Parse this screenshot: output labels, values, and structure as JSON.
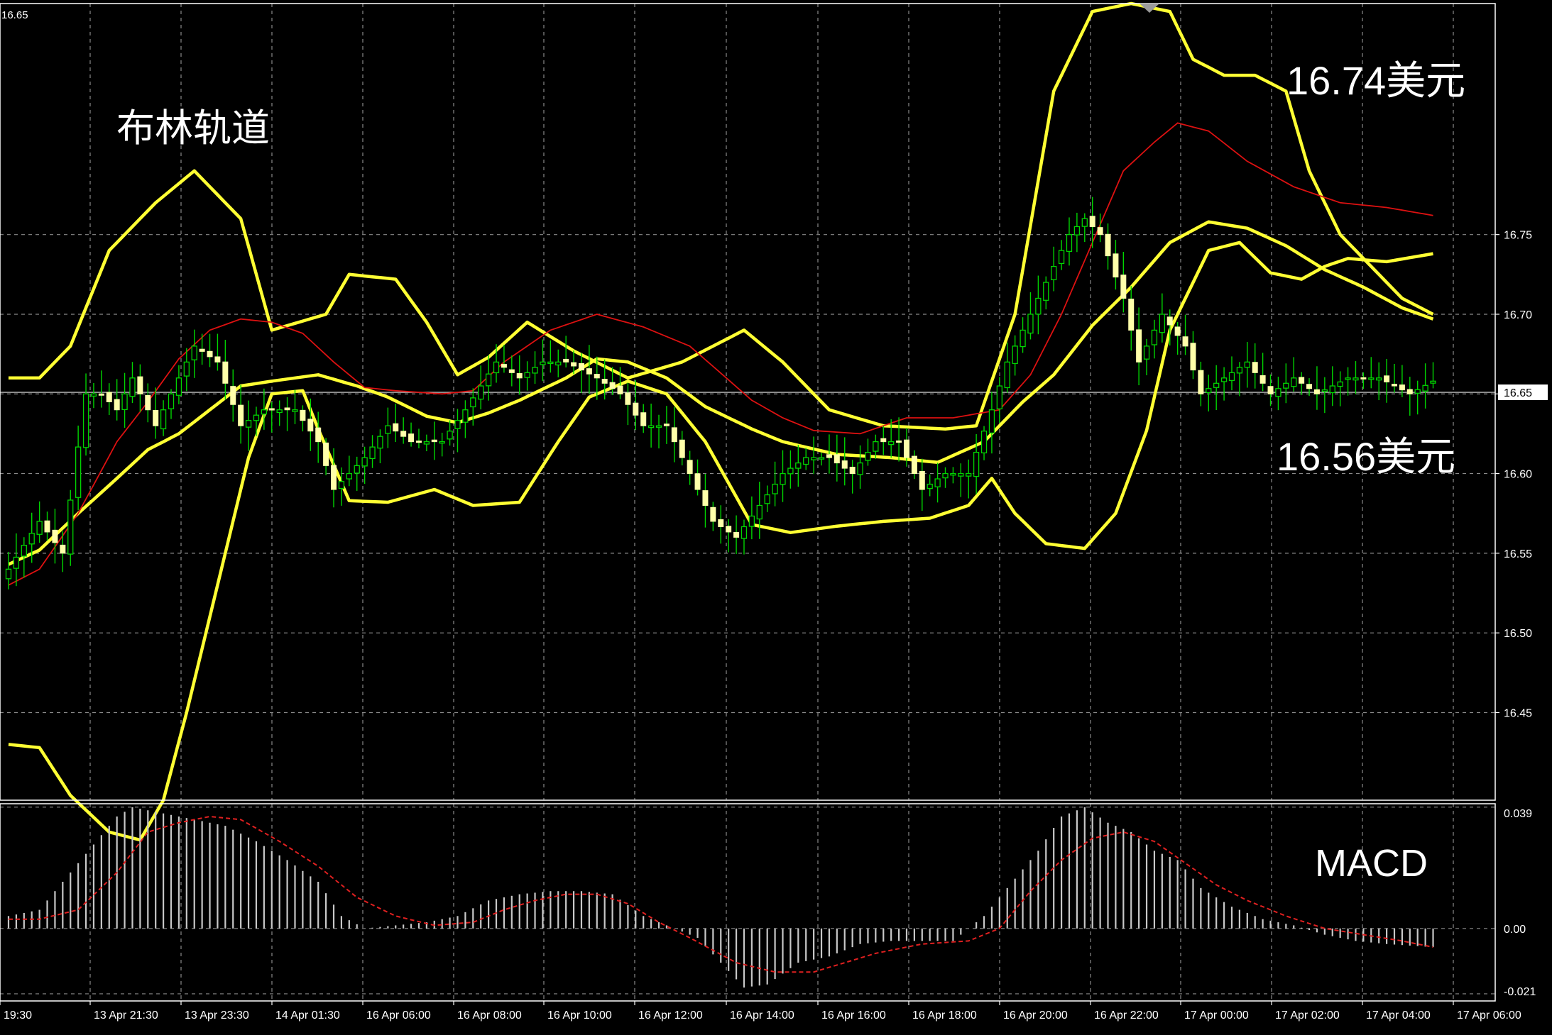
{
  "colors": {
    "background": "#000000",
    "frame": "#ffffff",
    "grid": "#b8b8b8",
    "axis_text": "#ffffff",
    "bull_wick": "#00d400",
    "bull_body": "#000000",
    "bear_body": "#ffffaa",
    "bollinger": "#ffff33",
    "moving_average": "#dd1111",
    "macd_hist": "#c8c8c8",
    "macd_signal": "#e02020",
    "price_line": "#c0c0c0"
  },
  "annotations": {
    "title": "布林轨道",
    "upper_price": "16.74美元",
    "lower_price": "16.56美元",
    "macd_label": "MACD"
  },
  "chart_data": [
    {
      "type": "candlestick",
      "title": "布林轨道",
      "top_left_price": "16.65",
      "ylim": [
        16.395,
        16.895
      ],
      "y_ticks": [
        "16.75",
        "16.70",
        "16.65",
        "16.60",
        "16.55",
        "16.50",
        "16.45"
      ],
      "y_tick_values": [
        16.75,
        16.7,
        16.65,
        16.6,
        16.55,
        16.5,
        16.45
      ],
      "current_price": "16.65",
      "current_price_value": 16.651,
      "x_labels": [
        "19:30",
        "13 Apr 21:30",
        "13 Apr 23:30",
        "14 Apr 01:30",
        "16 Apr 06:00",
        "16 Apr 08:00",
        "16 Apr 10:00",
        "16 Apr 12:00",
        "16 Apr 14:00",
        "16 Apr 16:00",
        "16 Apr 18:00",
        "16 Apr 20:00",
        "16 Apr 22:00",
        "17 Apr 00:00",
        "17 Apr 02:00",
        "17 Apr 04:00",
        "17 Apr 06:00"
      ],
      "bar_count": 185,
      "close_anchors": [
        [
          0,
          16.54
        ],
        [
          4,
          16.57
        ],
        [
          7,
          16.55
        ],
        [
          10,
          16.65
        ],
        [
          12,
          16.65
        ],
        [
          14,
          16.64
        ],
        [
          16,
          16.66
        ],
        [
          19,
          16.63
        ],
        [
          21,
          16.65
        ],
        [
          24,
          16.68
        ],
        [
          27,
          16.67
        ],
        [
          30,
          16.63
        ],
        [
          33,
          16.64
        ],
        [
          37,
          16.64
        ],
        [
          40,
          16.62
        ],
        [
          42,
          16.59
        ],
        [
          46,
          16.61
        ],
        [
          49,
          16.63
        ],
        [
          52,
          16.62
        ],
        [
          56,
          16.62
        ],
        [
          59,
          16.64
        ],
        [
          63,
          16.67
        ],
        [
          66,
          16.66
        ],
        [
          69,
          16.67
        ],
        [
          72,
          16.67
        ],
        [
          76,
          16.66
        ],
        [
          79,
          16.65
        ],
        [
          82,
          16.63
        ],
        [
          85,
          16.63
        ],
        [
          88,
          16.6
        ],
        [
          91,
          16.57
        ],
        [
          94,
          16.56
        ],
        [
          97,
          16.58
        ],
        [
          100,
          16.6
        ],
        [
          103,
          16.61
        ],
        [
          106,
          16.61
        ],
        [
          109,
          16.6
        ],
        [
          112,
          16.62
        ],
        [
          115,
          16.62
        ],
        [
          118,
          16.59
        ],
        [
          121,
          16.6
        ],
        [
          124,
          16.6
        ],
        [
          127,
          16.64
        ],
        [
          129,
          16.67
        ],
        [
          131,
          16.69
        ],
        [
          134,
          16.72
        ],
        [
          137,
          16.75
        ],
        [
          139,
          16.76
        ],
        [
          141,
          16.75
        ],
        [
          144,
          16.71
        ],
        [
          146,
          16.67
        ],
        [
          149,
          16.7
        ],
        [
          152,
          16.68
        ],
        [
          154,
          16.65
        ],
        [
          157,
          16.66
        ],
        [
          160,
          16.67
        ],
        [
          163,
          16.65
        ],
        [
          166,
          16.66
        ],
        [
          169,
          16.65
        ],
        [
          173,
          16.66
        ],
        [
          177,
          16.66
        ],
        [
          181,
          16.65
        ],
        [
          184,
          16.658
        ]
      ],
      "bollinger_upper_anchors": [
        [
          0,
          16.66
        ],
        [
          4,
          16.66
        ],
        [
          8,
          16.68
        ],
        [
          13,
          16.74
        ],
        [
          19,
          16.77
        ],
        [
          24,
          16.79
        ],
        [
          30,
          16.76
        ],
        [
          34,
          16.69
        ],
        [
          41,
          16.7
        ],
        [
          44,
          16.725
        ],
        [
          50,
          16.722
        ],
        [
          54,
          16.695
        ],
        [
          58,
          16.662
        ],
        [
          62,
          16.673
        ],
        [
          67,
          16.695
        ],
        [
          73,
          16.677
        ],
        [
          80,
          16.66
        ],
        [
          87,
          16.67
        ],
        [
          95,
          16.69
        ],
        [
          100,
          16.67
        ],
        [
          106,
          16.64
        ],
        [
          113,
          16.63
        ],
        [
          121,
          16.628
        ],
        [
          125,
          16.63
        ],
        [
          130,
          16.7
        ],
        [
          135,
          16.84
        ],
        [
          140,
          16.89
        ],
        [
          145,
          16.895
        ],
        [
          150,
          16.89
        ],
        [
          153,
          16.86
        ],
        [
          157,
          16.85
        ],
        [
          161,
          16.85
        ],
        [
          165,
          16.84
        ],
        [
          168,
          16.79
        ],
        [
          172,
          16.75
        ],
        [
          176,
          16.73
        ],
        [
          180,
          16.71
        ],
        [
          184,
          16.7
        ]
      ],
      "bollinger_middle_anchors": [
        [
          0,
          16.543
        ],
        [
          4,
          16.552
        ],
        [
          9,
          16.575
        ],
        [
          14,
          16.597
        ],
        [
          18,
          16.615
        ],
        [
          22,
          16.625
        ],
        [
          26,
          16.64
        ],
        [
          30,
          16.655
        ],
        [
          34,
          16.658
        ],
        [
          40,
          16.662
        ],
        [
          45,
          16.655
        ],
        [
          49,
          16.648
        ],
        [
          54,
          16.636
        ],
        [
          58,
          16.632
        ],
        [
          62,
          16.638
        ],
        [
          66,
          16.646
        ],
        [
          72,
          16.66
        ],
        [
          76,
          16.672
        ],
        [
          80,
          16.67
        ],
        [
          85,
          16.66
        ],
        [
          90,
          16.642
        ],
        [
          96,
          16.628
        ],
        [
          100,
          16.62
        ],
        [
          107,
          16.612
        ],
        [
          114,
          16.61
        ],
        [
          120,
          16.607
        ],
        [
          126,
          16.62
        ],
        [
          131,
          16.645
        ],
        [
          135,
          16.662
        ],
        [
          140,
          16.693
        ],
        [
          145,
          16.717
        ],
        [
          150,
          16.745
        ],
        [
          155,
          16.758
        ],
        [
          160,
          16.754
        ],
        [
          165,
          16.743
        ],
        [
          170,
          16.728
        ],
        [
          175,
          16.717
        ],
        [
          180,
          16.704
        ],
        [
          184,
          16.697
        ]
      ],
      "bollinger_lower_anchors": [
        [
          0,
          16.43
        ],
        [
          4,
          16.428
        ],
        [
          8,
          16.398
        ],
        [
          13,
          16.375
        ],
        [
          17,
          16.37
        ],
        [
          20,
          16.395
        ],
        [
          23,
          16.45
        ],
        [
          27,
          16.53
        ],
        [
          31,
          16.61
        ],
        [
          34,
          16.65
        ],
        [
          38,
          16.652
        ],
        [
          40,
          16.628
        ],
        [
          44,
          16.583
        ],
        [
          49,
          16.582
        ],
        [
          55,
          16.59
        ],
        [
          60,
          16.58
        ],
        [
          66,
          16.582
        ],
        [
          71,
          16.62
        ],
        [
          75,
          16.648
        ],
        [
          80,
          16.658
        ],
        [
          85,
          16.65
        ],
        [
          90,
          16.62
        ],
        [
          96,
          16.568
        ],
        [
          101,
          16.563
        ],
        [
          107,
          16.567
        ],
        [
          113,
          16.57
        ],
        [
          119,
          16.572
        ],
        [
          124,
          16.58
        ],
        [
          127,
          16.597
        ],
        [
          130,
          16.575
        ],
        [
          134,
          16.556
        ],
        [
          139,
          16.553
        ],
        [
          143,
          16.575
        ],
        [
          147,
          16.627
        ],
        [
          150,
          16.69
        ],
        [
          155,
          16.74
        ],
        [
          159,
          16.745
        ],
        [
          163,
          16.726
        ],
        [
          167,
          16.722
        ],
        [
          170,
          16.73
        ],
        [
          173,
          16.735
        ],
        [
          178,
          16.733
        ],
        [
          184,
          16.738
        ]
      ],
      "moving_average_anchors": [
        [
          0,
          16.53
        ],
        [
          4,
          16.54
        ],
        [
          9,
          16.575
        ],
        [
          14,
          16.62
        ],
        [
          18,
          16.645
        ],
        [
          22,
          16.672
        ],
        [
          26,
          16.69
        ],
        [
          30,
          16.697
        ],
        [
          34,
          16.695
        ],
        [
          38,
          16.688
        ],
        [
          42,
          16.67
        ],
        [
          46,
          16.654
        ],
        [
          50,
          16.652
        ],
        [
          56,
          16.65
        ],
        [
          60,
          16.652
        ],
        [
          64,
          16.67
        ],
        [
          70,
          16.69
        ],
        [
          76,
          16.7
        ],
        [
          82,
          16.692
        ],
        [
          88,
          16.68
        ],
        [
          92,
          16.663
        ],
        [
          96,
          16.646
        ],
        [
          100,
          16.635
        ],
        [
          104,
          16.627
        ],
        [
          110,
          16.625
        ],
        [
          116,
          16.635
        ],
        [
          122,
          16.635
        ],
        [
          128,
          16.64
        ],
        [
          132,
          16.662
        ],
        [
          136,
          16.7
        ],
        [
          140,
          16.745
        ],
        [
          144,
          16.79
        ],
        [
          148,
          16.808
        ],
        [
          151,
          16.82
        ],
        [
          155,
          16.815
        ],
        [
          160,
          16.796
        ],
        [
          166,
          16.78
        ],
        [
          172,
          16.77
        ],
        [
          178,
          16.767
        ],
        [
          184,
          16.762
        ]
      ]
    },
    {
      "type": "bar",
      "title": "MACD",
      "ylim": [
        -0.0233,
        0.0401
      ],
      "y_ticks": [
        "0.039",
        "0.00",
        "-0.021"
      ],
      "y_tick_values": [
        0.039,
        0.0,
        -0.021
      ],
      "hist_anchors": [
        [
          0,
          0.004
        ],
        [
          4,
          0.006
        ],
        [
          8,
          0.018
        ],
        [
          11,
          0.027
        ],
        [
          14,
          0.036
        ],
        [
          16,
          0.039
        ],
        [
          20,
          0.037
        ],
        [
          24,
          0.035
        ],
        [
          28,
          0.033
        ],
        [
          32,
          0.028
        ],
        [
          36,
          0.022
        ],
        [
          40,
          0.015
        ],
        [
          43,
          0.004
        ],
        [
          46,
          0.0
        ],
        [
          50,
          0.001
        ],
        [
          54,
          0.002
        ],
        [
          58,
          0.004
        ],
        [
          62,
          0.009
        ],
        [
          66,
          0.011
        ],
        [
          70,
          0.012
        ],
        [
          74,
          0.012
        ],
        [
          78,
          0.011
        ],
        [
          82,
          0.004
        ],
        [
          86,
          0.0
        ],
        [
          89,
          -0.003
        ],
        [
          92,
          -0.011
        ],
        [
          95,
          -0.019
        ],
        [
          98,
          -0.018
        ],
        [
          102,
          -0.011
        ],
        [
          106,
          -0.009
        ],
        [
          110,
          -0.005
        ],
        [
          114,
          -0.004
        ],
        [
          118,
          -0.004
        ],
        [
          122,
          -0.004
        ],
        [
          126,
          0.004
        ],
        [
          129,
          0.013
        ],
        [
          133,
          0.025
        ],
        [
          136,
          0.036
        ],
        [
          139,
          0.039
        ],
        [
          142,
          0.034
        ],
        [
          145,
          0.031
        ],
        [
          148,
          0.025
        ],
        [
          151,
          0.022
        ],
        [
          154,
          0.013
        ],
        [
          158,
          0.007
        ],
        [
          162,
          0.003
        ],
        [
          166,
          0.001
        ],
        [
          170,
          -0.002
        ],
        [
          174,
          -0.004
        ],
        [
          178,
          -0.005
        ],
        [
          184,
          -0.006
        ]
      ],
      "signal_anchors": [
        [
          0,
          0.003
        ],
        [
          4,
          0.003
        ],
        [
          9,
          0.006
        ],
        [
          14,
          0.018
        ],
        [
          18,
          0.031
        ],
        [
          22,
          0.034
        ],
        [
          26,
          0.036
        ],
        [
          30,
          0.035
        ],
        [
          35,
          0.028
        ],
        [
          40,
          0.02
        ],
        [
          45,
          0.01
        ],
        [
          50,
          0.004
        ],
        [
          55,
          0.001
        ],
        [
          60,
          0.002
        ],
        [
          64,
          0.006
        ],
        [
          68,
          0.009
        ],
        [
          72,
          0.011
        ],
        [
          76,
          0.011
        ],
        [
          80,
          0.008
        ],
        [
          84,
          0.002
        ],
        [
          88,
          -0.003
        ],
        [
          94,
          -0.011
        ],
        [
          99,
          -0.014
        ],
        [
          104,
          -0.014
        ],
        [
          108,
          -0.011
        ],
        [
          112,
          -0.008
        ],
        [
          118,
          -0.005
        ],
        [
          124,
          -0.004
        ],
        [
          128,
          0.0
        ],
        [
          132,
          0.012
        ],
        [
          136,
          0.022
        ],
        [
          140,
          0.029
        ],
        [
          144,
          0.031
        ],
        [
          148,
          0.028
        ],
        [
          152,
          0.021
        ],
        [
          156,
          0.014
        ],
        [
          160,
          0.009
        ],
        [
          165,
          0.004
        ],
        [
          170,
          0.0
        ],
        [
          175,
          -0.002
        ],
        [
          180,
          -0.004
        ],
        [
          184,
          -0.006
        ]
      ]
    }
  ]
}
